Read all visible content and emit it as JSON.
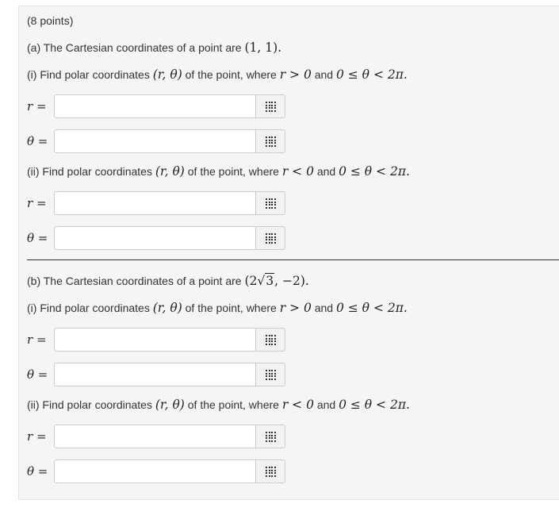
{
  "points": "(8 points)",
  "a": {
    "intro": "(a) The Cartesian coordinates of a point are",
    "point": "(1, 1).",
    "i": {
      "prefix": "(i) Find polar coordinates",
      "coords": "(r, θ)",
      "mid": "of the point, where",
      "r_cond": "r > 0",
      "and": "and",
      "theta_cond": "0 ≤ θ < 2π."
    },
    "ii": {
      "prefix": "(ii) Find polar coordinates",
      "coords": "(r, θ)",
      "mid": "of the point, where",
      "r_cond": "r < 0",
      "and": "and",
      "theta_cond": "0 ≤ θ < 2π."
    }
  },
  "b": {
    "intro": "(b) The Cartesian coordinates of a point are",
    "point_open": "(2",
    "sqrt_arg": "3",
    "point_close": ", −2).",
    "i": {
      "prefix": "(i) Find polar coordinates",
      "coords": "(r, θ)",
      "mid": "of the point, where",
      "r_cond": "r > 0",
      "and": "and",
      "theta_cond": "0 ≤ θ < 2π."
    },
    "ii": {
      "prefix": "(ii) Find polar coordinates",
      "coords": "(r, θ)",
      "mid": "of the point, where",
      "r_cond": "r < 0",
      "and": "and",
      "theta_cond": "0 ≤ θ < 2π."
    }
  },
  "labels": {
    "r": "r =",
    "theta": "θ ="
  },
  "answers": {
    "a_i_r": "",
    "a_i_theta": "",
    "a_ii_r": "",
    "a_ii_theta": "",
    "b_i_r": "",
    "b_i_theta": "",
    "b_ii_r": "",
    "b_ii_theta": ""
  },
  "icons": {
    "equation_editor": "grid-icon"
  }
}
